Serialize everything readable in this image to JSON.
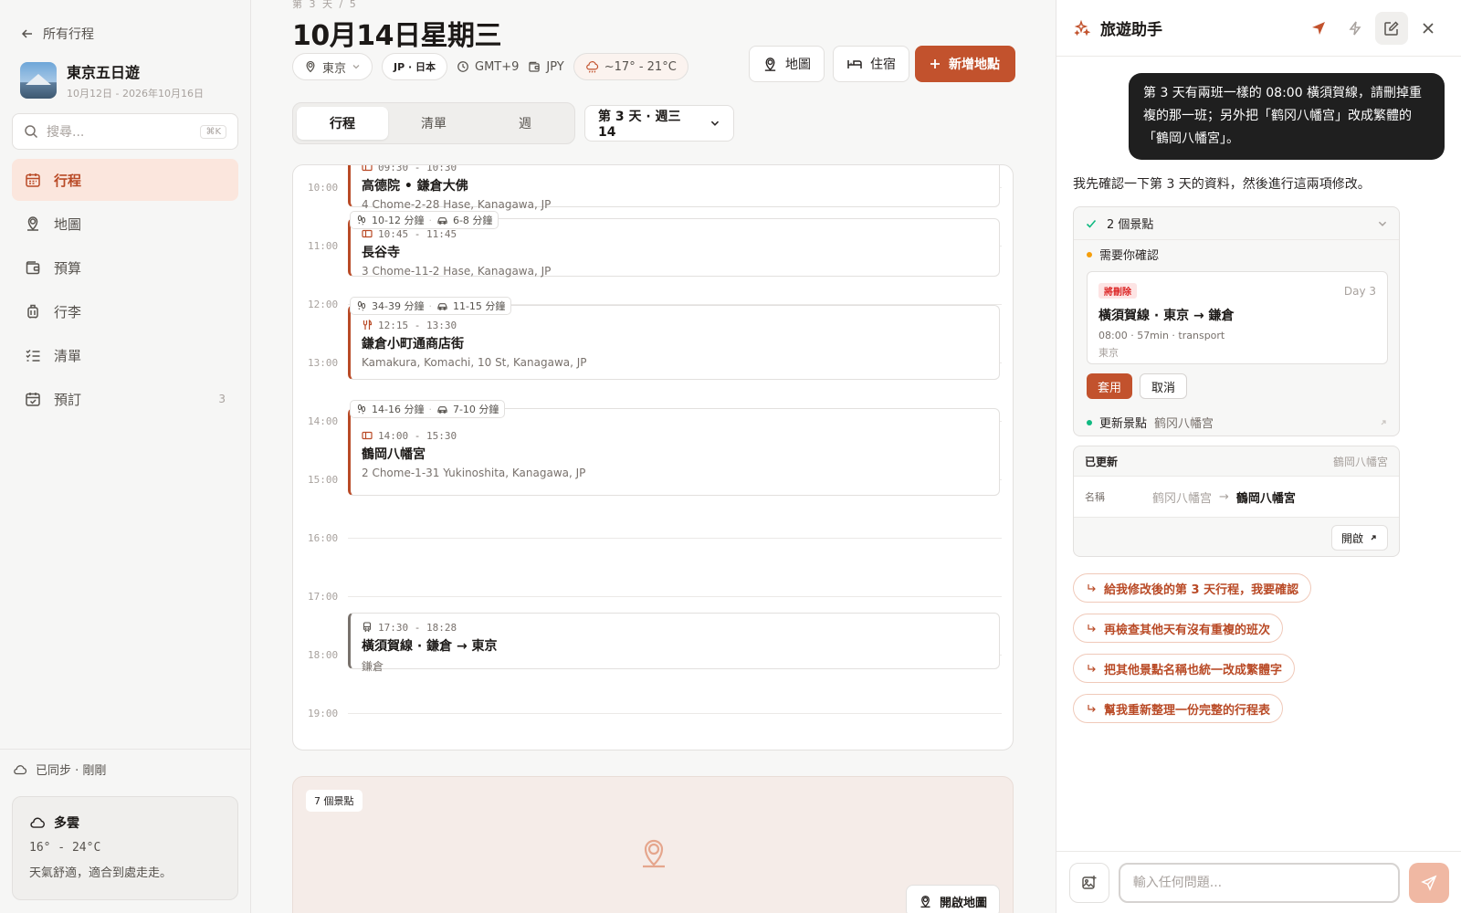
{
  "sidebar": {
    "back_label": "所有行程",
    "trip_title": "東京五日遊",
    "trip_dates": "10月12日 - 2026年10月16日",
    "search_placeholder": "搜尋...",
    "search_shortcut": "⌘K",
    "nav": [
      {
        "label": "行程",
        "icon": "calendar-icon",
        "active": true
      },
      {
        "label": "地圖",
        "icon": "map-pin-icon"
      },
      {
        "label": "預算",
        "icon": "wallet-icon"
      },
      {
        "label": "行李",
        "icon": "luggage-icon"
      },
      {
        "label": "清單",
        "icon": "checklist-icon"
      },
      {
        "label": "預訂",
        "icon": "calendar-check-icon",
        "count": "3"
      }
    ],
    "sync_status": "已同步 · 剛剛",
    "weather": {
      "condition": "多雲",
      "range": "16° - 24°C",
      "note": "天氣舒適，適合到處走走。"
    }
  },
  "main": {
    "day_crumb": "第 3 天 / 5",
    "date_title": "10月14日星期三",
    "meta": {
      "city": "東京",
      "country": "JP · 日本",
      "timezone": "GMT+9",
      "currency": "JPY",
      "weather": "~17° - 21°C"
    },
    "buttons": {
      "map": "地圖",
      "lodging": "住宿",
      "add_place": "新增地點"
    },
    "tabs": [
      "行程",
      "清單",
      "週"
    ],
    "day_select": "第 3 天 · 週三 14",
    "hours": [
      "10:00",
      "11:00",
      "12:00",
      "13:00",
      "14:00",
      "15:00",
      "16:00",
      "17:00",
      "18:00",
      "19:00"
    ],
    "events": [
      {
        "time": "09:30 - 10:30",
        "name": "高德院 • 鎌倉大佛",
        "address": "4 Chome-2-28 Hase, Kanagawa, JP"
      },
      {
        "time": "10:45 - 11:45",
        "name": "長谷寺",
        "address": "3 Chome-11-2 Hase, Kanagawa, JP"
      },
      {
        "time": "12:15 - 13:30",
        "name": "鎌倉小町通商店街",
        "address": "Kamakura, Komachi, 10 St, Kanagawa, JP"
      },
      {
        "time": "14:00 - 15:30",
        "name": "鶴岡八幡宮",
        "address": "2 Chome-1-31 Yukinoshita, Kanagawa, JP"
      },
      {
        "time": "17:30 - 18:28",
        "name": "橫須賀線 · 鎌倉 → 東京",
        "address": "鎌倉"
      }
    ],
    "travel": [
      {
        "walk": "10-12 分鐘",
        "car": "6-8 分鐘"
      },
      {
        "walk": "34-39 分鐘",
        "car": "11-15 分鐘"
      },
      {
        "walk": "14-16 分鐘",
        "car": "7-10 分鐘"
      }
    ],
    "map_card": {
      "badge": "7 個景點",
      "open_label": "開啟地圖"
    }
  },
  "assistant": {
    "title": "旅遊助手",
    "user_message": "第 3 天有兩班一樣的 08:00 橫須賀線，請刪掉重複的那一班；另外把「鹤冈八幡宫」改成繁體的「鶴岡八幡宮」。",
    "reply": "我先確認一下第 3 天的資料，然後進行這兩項修改。",
    "tool": {
      "summary": "2 個景點",
      "confirm_title": "需要你確認",
      "delete_badge": "將刪除",
      "day": "Day 3",
      "delete_name": "橫須賀線 · 東京 → 鎌倉",
      "delete_meta": "08:00 · 57min · transport",
      "delete_location": "東京",
      "apply": "套用",
      "cancel": "取消",
      "update_label": "更新景點",
      "update_value": "鹤冈八幡宫"
    },
    "updated": {
      "title": "已更新",
      "target": "鶴岡八幡宮",
      "field_label": "名稱",
      "old_value": "鹤冈八幡宫",
      "arrow": "→",
      "new_value": "鶴岡八幡宮",
      "open_label": "開啟"
    },
    "suggestions": [
      "給我修改後的第 3 天行程，我要確認",
      "再檢查其他天有沒有重複的班次",
      "把其他景點名稱也統一改成繁體字",
      "幫我重新整理一份完整的行程表"
    ],
    "input_placeholder": "輸入任何問題..."
  },
  "colors": {
    "accent": "#c2522d",
    "accent_soft": "#fbe6dd",
    "confirm_dot": "#f59e0b",
    "success_dot": "#10b981",
    "danger": "#dc2626"
  }
}
